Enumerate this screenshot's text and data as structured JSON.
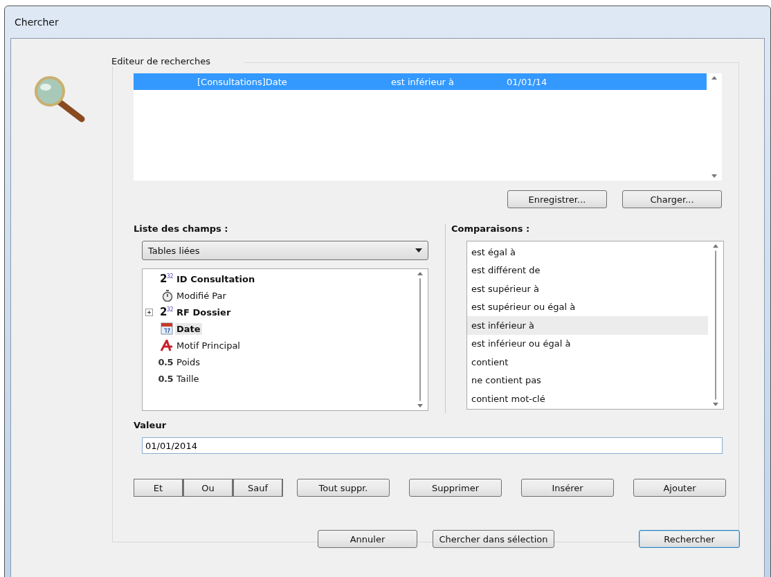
{
  "window": {
    "title": "Chercher"
  },
  "editor": {
    "title": "Editeur de recherches",
    "rows": [
      {
        "field": "[Consultations]Date",
        "operator": "est inférieur à",
        "value": "01/01/14",
        "selected": true
      }
    ],
    "buttons": [
      "Enregistrer...",
      "Charger..."
    ]
  },
  "fields": {
    "label": "Liste des champs :",
    "dropdown": "Tables liées",
    "items": [
      {
        "kind": "integer",
        "type_label": "2$^{32}$",
        "name": "ID Consultation",
        "bold": true,
        "selected": false
      },
      {
        "kind": "time",
        "name": "Modifié Par",
        "bold": false,
        "selected": false
      },
      {
        "kind": "integer",
        "type_label": "2$^{32}$",
        "name": "RF Dossier",
        "bold": true,
        "selected": false,
        "expanded": false
      },
      {
        "kind": "date",
        "name": "Date",
        "bold": true,
        "selected": true
      },
      {
        "kind": "text",
        "name": "Motif Principal",
        "bold": false,
        "selected": false
      },
      {
        "kind": "real",
        "type_label": "0.5",
        "name": "Poids",
        "bold": false,
        "selected": false
      },
      {
        "kind": "real",
        "type_label": "0.5",
        "name": "Taille",
        "bold": false,
        "selected": false
      }
    ]
  },
  "comparisons": {
    "label": "Comparaisons :",
    "items": [
      {
        "label": "est égal à",
        "selected": false
      },
      {
        "label": "est différent de",
        "selected": false
      },
      {
        "label": "est supérieur à",
        "selected": false
      },
      {
        "label": "est supérieur ou égal à",
        "selected": false
      },
      {
        "label": "est inférieur à",
        "selected": true
      },
      {
        "label": "est inférieur ou égal à",
        "selected": false
      },
      {
        "label": "contient",
        "selected": false
      },
      {
        "label": "ne contient pas",
        "selected": false
      },
      {
        "label": "contient mot-clé",
        "selected": false
      }
    ]
  },
  "value": {
    "label": "Valeur",
    "value": "01/01/2014"
  },
  "logic_buttons": [
    "Et",
    "Ou",
    "Sauf"
  ],
  "action_buttons": [
    "Tout suppr.",
    "Supprimer",
    "Insérer",
    "Ajouter"
  ],
  "footer_buttons": [
    {
      "label": "Annuler",
      "default": false
    },
    {
      "label": "Chercher dans sélection",
      "default": false
    },
    {
      "label": "Rechercher",
      "default": true
    }
  ]
}
